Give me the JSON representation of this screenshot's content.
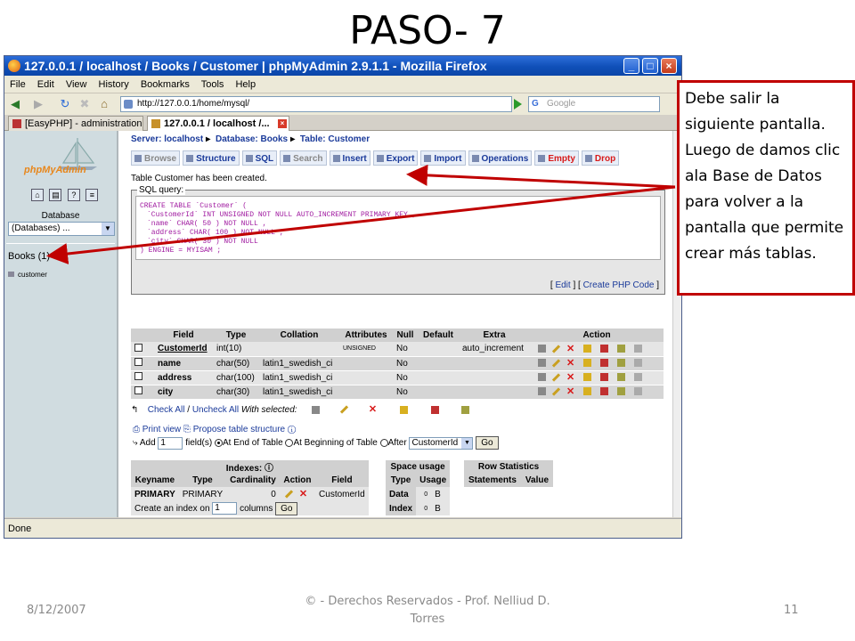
{
  "slide": {
    "title": "PASO- 7",
    "callout": "Debe salir la siguiente pantalla. Luego de damos clic ala Base de Datos para volver a la pantalla que permite crear más tablas.",
    "footer_date": "8/12/2007",
    "footer_copy": "© - Derechos Reservados  - Prof. Nelliud D. Torres",
    "page_number": "11"
  },
  "browser": {
    "title": "127.0.0.1 / localhost / Books / Customer | phpMyAdmin 2.9.1.1 - Mozilla Firefox",
    "menu": [
      "File",
      "Edit",
      "View",
      "History",
      "Bookmarks",
      "Tools",
      "Help"
    ],
    "url": "http://127.0.0.1/home/mysql/",
    "search_placeholder": "Google",
    "tabs": [
      "[EasyPHP] - administration",
      "127.0.0.1 / localhost /..."
    ],
    "status": "Done"
  },
  "left": {
    "logo_text": "phpMyAdmin",
    "database_label": "Database",
    "database_select": "(Databases) ...",
    "books": "Books (1)",
    "table_item": "customer"
  },
  "main": {
    "crumb_server": "Server: localhost",
    "crumb_db": "Database: Books",
    "crumb_table": "Table: Customer",
    "tabs": [
      "Browse",
      "Structure",
      "SQL",
      "Search",
      "Insert",
      "Export",
      "Import",
      "Operations",
      "Empty",
      "Drop"
    ],
    "created_msg": "Table Customer has been created.",
    "sql_legend": "SQL query:",
    "sql_lines": [
      "CREATE TABLE `Customer` (",
      "`CustomerId` INT UNSIGNED NOT NULL AUTO_INCREMENT PRIMARY KEY ,",
      "`name` CHAR( 50 ) NOT NULL ,",
      "`address` CHAR( 100 ) NOT NULL ,",
      "`city` CHAR( 30 ) NOT NULL",
      ") ENGINE = MYISAM ;"
    ],
    "sql_edit": "Edit",
    "sql_php": "Create PHP Code",
    "field_headers": [
      "Field",
      "Type",
      "Collation",
      "Attributes",
      "Null",
      "Default",
      "Extra",
      "Action"
    ],
    "fields": [
      {
        "field": "CustomerId",
        "type": "int(10)",
        "collation": "",
        "attributes": "UNSIGNED",
        "null": "No",
        "default": "",
        "extra": "auto_increment"
      },
      {
        "field": "name",
        "type": "char(50)",
        "collation": "latin1_swedish_ci",
        "attributes": "",
        "null": "No",
        "default": "",
        "extra": ""
      },
      {
        "field": "address",
        "type": "char(100)",
        "collation": "latin1_swedish_ci",
        "attributes": "",
        "null": "No",
        "default": "",
        "extra": ""
      },
      {
        "field": "city",
        "type": "char(30)",
        "collation": "latin1_swedish_ci",
        "attributes": "",
        "null": "No",
        "default": "",
        "extra": ""
      }
    ],
    "check_all": "Check All",
    "uncheck_all": "Uncheck All",
    "with_selected": "With selected:",
    "print_view": "Print view",
    "propose": "Propose table structure",
    "add_label": "Add",
    "add_value": "1",
    "fields_label": "field(s)",
    "at_end": "At End of Table",
    "at_begin": "At Beginning of Table",
    "after": "After",
    "after_select": "CustomerId",
    "go": "Go",
    "indexes_title": "Indexes:",
    "index_headers": [
      "Keyname",
      "Type",
      "Cardinality",
      "Action",
      "Field"
    ],
    "index_row": {
      "keyname": "PRIMARY",
      "type": "PRIMARY",
      "cardinality": "0",
      "field": "CustomerId"
    },
    "create_index_label": "Create an index on",
    "create_index_value": "1",
    "columns_label": "columns",
    "space_title": "Space usage",
    "space_headers": [
      "Type",
      "Usage"
    ],
    "space_rows": [
      {
        "type": "Data",
        "value": "0",
        "unit": "B"
      },
      {
        "type": "Index",
        "value": "0",
        "unit": "B"
      }
    ],
    "rowstat_title": "Row Statistics",
    "rowstat_headers": [
      "Statements",
      "Value"
    ]
  }
}
